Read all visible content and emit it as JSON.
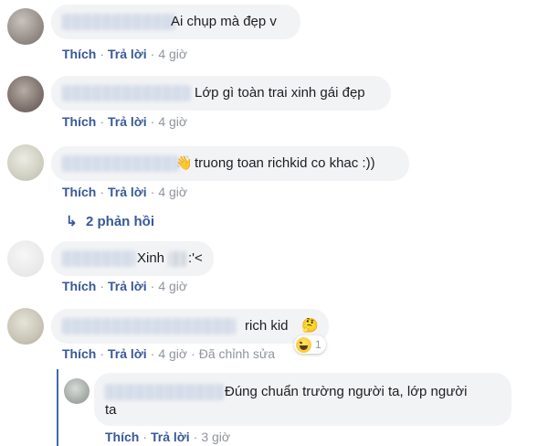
{
  "comments": [
    {
      "text": "Ai chụp mà đẹp v",
      "actions": {
        "like": "Thích",
        "reply": "Trả lời",
        "sep": "·",
        "time": "4 giờ"
      }
    },
    {
      "text": "Lớp gì toàn trai xinh gái đẹp",
      "actions": {
        "like": "Thích",
        "reply": "Trả lời",
        "sep": "·",
        "time": "4 giờ"
      }
    },
    {
      "emoji": "👋",
      "text": "truong toan richkid co khac :))",
      "actions": {
        "like": "Thích",
        "reply": "Trả lời",
        "sep": "·",
        "time": "4 giờ"
      }
    },
    {
      "text_a": "Xinh",
      "text_b": ":'<",
      "actions": {
        "like": "Thích",
        "reply": "Trả lời",
        "sep": "·",
        "time": "4 giờ"
      }
    },
    {
      "text": "rich kid",
      "emoji": "🤔",
      "actions": {
        "like": "Thích",
        "reply": "Trả lời",
        "sep": "·",
        "time": "4 giờ",
        "edited": "Đã chỉnh sửa"
      },
      "reaction": {
        "icon": "laughing-face",
        "count": "1"
      }
    }
  ],
  "replies_link": {
    "arrow": "↳",
    "label": "2 phản hồi"
  },
  "reply": {
    "line1": "Đúng chuẩn trường người ta, lớp người",
    "line2": "ta",
    "actions": {
      "like": "Thích",
      "reply": "Trả lời",
      "sep": "·",
      "time": "3 giờ"
    }
  },
  "colors": {
    "link": "#385898",
    "bubble": "#f2f3f5",
    "meta": "#90949c",
    "thread": "#4267b2"
  }
}
